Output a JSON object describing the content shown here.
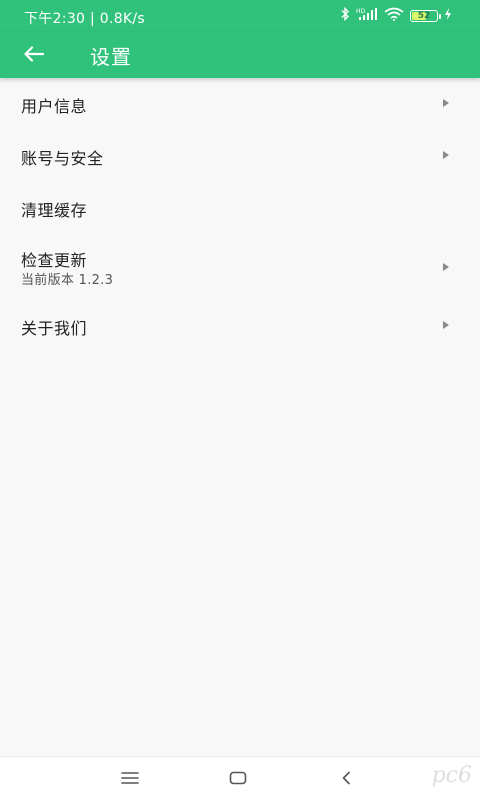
{
  "status_bar": {
    "left_text": "下午2:30 | 0.8K/s",
    "battery_level": "52",
    "icons": [
      "bluetooth-icon",
      "hd-signal-icon",
      "wifi-icon",
      "battery-icon",
      "charging-icon"
    ]
  },
  "app_bar": {
    "title": "设置",
    "back_icon": "arrow-left-icon",
    "color": "#30c27b"
  },
  "settings": {
    "items": [
      {
        "label": "用户信息",
        "has_chevron": true
      },
      {
        "label": "账号与安全",
        "has_chevron": true
      },
      {
        "label": "清理缓存",
        "has_chevron": false
      },
      {
        "label": "检查更新",
        "sublabel": "当前版本 1.2.3",
        "has_chevron": true
      },
      {
        "label": "关于我们",
        "has_chevron": true
      }
    ]
  },
  "nav_bar": {
    "buttons": [
      "menu-icon",
      "home-icon",
      "back-icon"
    ]
  },
  "watermark": {
    "text": "pc6"
  }
}
